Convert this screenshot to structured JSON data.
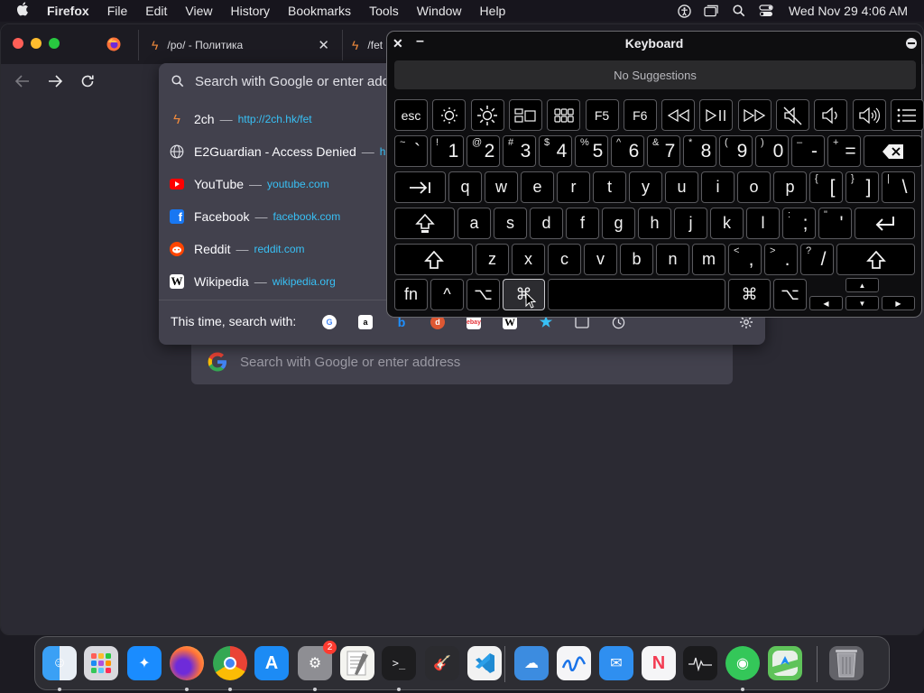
{
  "menubar": {
    "apple": "",
    "app_name": "Firefox",
    "items": [
      "File",
      "Edit",
      "View",
      "History",
      "Bookmarks",
      "Tools",
      "Window",
      "Help"
    ],
    "clock": "Wed Nov 29  4:06 AM",
    "icons": [
      "accessibility-icon",
      "window-icon",
      "spotlight-icon",
      "control-center-icon"
    ]
  },
  "firefox": {
    "tabs": [
      {
        "label": "/po/ - Политика",
        "icon": "lightning-icon"
      },
      {
        "label": "/fet",
        "icon": "lightning-icon"
      }
    ],
    "url_dropdown": {
      "placeholder": "Search with Google or enter address",
      "suggestions": [
        {
          "title": "2ch",
          "url": "http://2ch.hk/fet",
          "icon": "lightning-icon"
        },
        {
          "title": "E2Guardian - Access Denied",
          "url": "h",
          "icon": "globe-icon"
        },
        {
          "title": "YouTube",
          "url": "youtube.com",
          "icon": "youtube-icon"
        },
        {
          "title": "Facebook",
          "url": "facebook.com",
          "icon": "facebook-icon"
        },
        {
          "title": "Reddit",
          "url": "reddit.com",
          "icon": "reddit-icon"
        },
        {
          "title": "Wikipedia",
          "url": "wikipedia.org",
          "icon": "wikipedia-icon"
        }
      ],
      "dash": "—",
      "search_with_label": "This time, search with:",
      "engines": [
        "google",
        "amazon",
        "bing",
        "duckduckgo",
        "ebay",
        "wikipedia",
        "bookmarks",
        "tabs",
        "history"
      ]
    },
    "home_search_placeholder": "Search with Google or enter address"
  },
  "keyboard": {
    "title": "Keyboard",
    "suggestions": "No Suggestions",
    "fn_row": [
      "esc",
      "F5",
      "F6"
    ],
    "num_row": [
      {
        "top": "~",
        "main": "`"
      },
      {
        "top": "!",
        "main": "1"
      },
      {
        "top": "@",
        "main": "2"
      },
      {
        "top": "#",
        "main": "3"
      },
      {
        "top": "$",
        "main": "4"
      },
      {
        "top": "%",
        "main": "5"
      },
      {
        "top": "^",
        "main": "6"
      },
      {
        "top": "&",
        "main": "7"
      },
      {
        "top": "*",
        "main": "8"
      },
      {
        "top": "(",
        "main": "9"
      },
      {
        "top": ")",
        "main": "0"
      },
      {
        "top": "–",
        "main": "-"
      },
      {
        "top": "+",
        "main": "="
      }
    ],
    "row_q": [
      "q",
      "w",
      "e",
      "r",
      "t",
      "y",
      "u",
      "i",
      "o",
      "p"
    ],
    "row_q_extra": [
      {
        "top": "{",
        "main": "["
      },
      {
        "top": "}",
        "main": "]"
      },
      {
        "top": "|",
        "main": "\\"
      }
    ],
    "row_a": [
      "a",
      "s",
      "d",
      "f",
      "g",
      "h",
      "j",
      "k",
      "l"
    ],
    "row_a_extra": [
      {
        "top": ":",
        "main": ";"
      },
      {
        "top": "\"",
        "main": "'"
      }
    ],
    "row_z": [
      "z",
      "x",
      "c",
      "v",
      "b",
      "n",
      "m"
    ],
    "row_z_extra": [
      {
        "top": "<",
        "main": ","
      },
      {
        "top": ">",
        "main": "."
      },
      {
        "top": "?",
        "main": "/"
      }
    ],
    "bottom": {
      "fn": "fn",
      "ctrl": "^",
      "opt": "⌥",
      "cmd": "⌘"
    }
  },
  "dock": {
    "settings_badge": "2",
    "apps": [
      "finder",
      "launchpad",
      "safari",
      "firefox",
      "chrome",
      "app-store",
      "system-settings",
      "textedit",
      "terminal",
      "garageband",
      "vscode",
      "weather",
      "freeform",
      "mail",
      "news",
      "activity-monitor",
      "find-my",
      "maps",
      "trash"
    ]
  }
}
